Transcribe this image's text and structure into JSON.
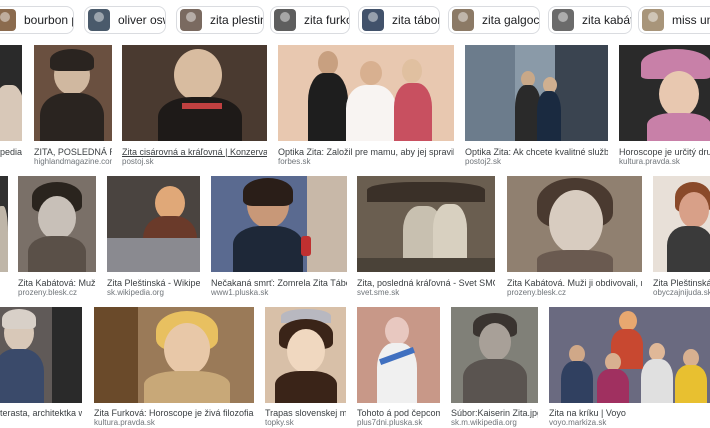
{
  "chips": [
    {
      "label": "bourbon parma",
      "color": "#8b6b4e"
    },
    {
      "label": "oliver oswald",
      "color": "#4a5a6b"
    },
    {
      "label": "zita plestinska",
      "color": "#7a6a60"
    },
    {
      "label": "zita furkova",
      "color": "#5e5e5e"
    },
    {
      "label": "zita táborská",
      "color": "#42526b"
    },
    {
      "label": "zita galgociova",
      "color": "#8c7a66"
    },
    {
      "label": "zita kabátová",
      "color": "#6b6b6b"
    },
    {
      "label": "miss univer",
      "color": "#a8957a"
    }
  ],
  "results": [
    {
      "title": "pedia",
      "source": "",
      "bg": "#2a2a2a",
      "person": "#d8c8b8"
    },
    {
      "title": "ZITA, POSLEDNÁ RAKÚ...",
      "source": "highlandmagazine.com",
      "bg": "#6a5040",
      "person": "#d0b8a0"
    },
    {
      "title": "Zita cisárovná a kráľovná | Konzervatívny den...",
      "source": "postoj.sk",
      "bg": "#4a3a30",
      "person": "#d8bca0"
    },
    {
      "title": "Optika Zita: Založil pre mamu, aby jej spravil radosť. Zák...",
      "source": "forbes.sk",
      "bg": "#e8c8b0",
      "person": "#f0e8e8"
    },
    {
      "title": "Optika Zita: Ak chcete kvalitné služby, musíte...",
      "source": "postoj2.sk",
      "bg": "#8a9aa8",
      "person": "#3a3a3a"
    },
    {
      "title": "Horoscope je určitý druh bláznov...",
      "source": "kultura.pravda.sk",
      "bg": "#2a2a2a",
      "person": "#c880a8"
    },
    {
      "title": "",
      "source": "",
      "bg": "#303030",
      "person": "#bfb6a8"
    },
    {
      "title": "Zita Kabátová: Muži ji o...",
      "source": "prozeny.blesk.cz",
      "bg": "#7a7068",
      "person": "#c8c0b8"
    },
    {
      "title": "Zita Pleštinská - Wikipedia",
      "source": "sk.wikipedia.org",
      "bg": "#4a4440",
      "person": "#e0a878"
    },
    {
      "title": "Nečakaná smrť: Zomrela Zita Táborská, m...",
      "source": "www1.pluska.sk",
      "bg": "#5a6a90",
      "person": "#c89878"
    },
    {
      "title": "Zita, posledná kráľovná - Svet SMC",
      "source": "svet.sme.sk",
      "bg": "#6a5e50",
      "person": "#c8c0b0"
    },
    {
      "title": "Zita Kabátová. Muži ji obdivovali, měla ava...",
      "source": "prozeny.blesk.cz",
      "bg": "#908070",
      "person": "#d8ccc0"
    },
    {
      "title": "Zita Pleštinská - W",
      "source": "obyczajnijuda.sk",
      "bg": "#e8e0d8",
      "person": "#d8a088"
    },
    {
      "title": "terasta, architektka ww...",
      "source": "",
      "bg": "#605a58",
      "person": "#d8c8b8"
    },
    {
      "title": "Zita Furková: Horoscope je živá filozofia · Divadlo · K...",
      "source": "kultura.pravda.sk",
      "bg": "#9a7a58",
      "person": "#e8c8a8"
    },
    {
      "title": "Trapas slovenskej mod...",
      "source": "topky.sk",
      "bg": "#d8c0a8",
      "person": "#f0d8c0"
    },
    {
      "title": "Tohoto á pod čepcom: Z...",
      "source": "plus7dni.pluska.sk",
      "bg": "#c89888",
      "person": "#e8c8c0"
    },
    {
      "title": "Súbor:Kaiserin Zita.jpg – ...",
      "source": "sk.m.wikipedia.org",
      "bg": "#808078",
      "person": "#a8a098"
    },
    {
      "title": "Zita na kríku | Voyo",
      "source": "voyo.markiza.sk",
      "bg": "#6a6a80",
      "person": "#e8a870"
    }
  ]
}
